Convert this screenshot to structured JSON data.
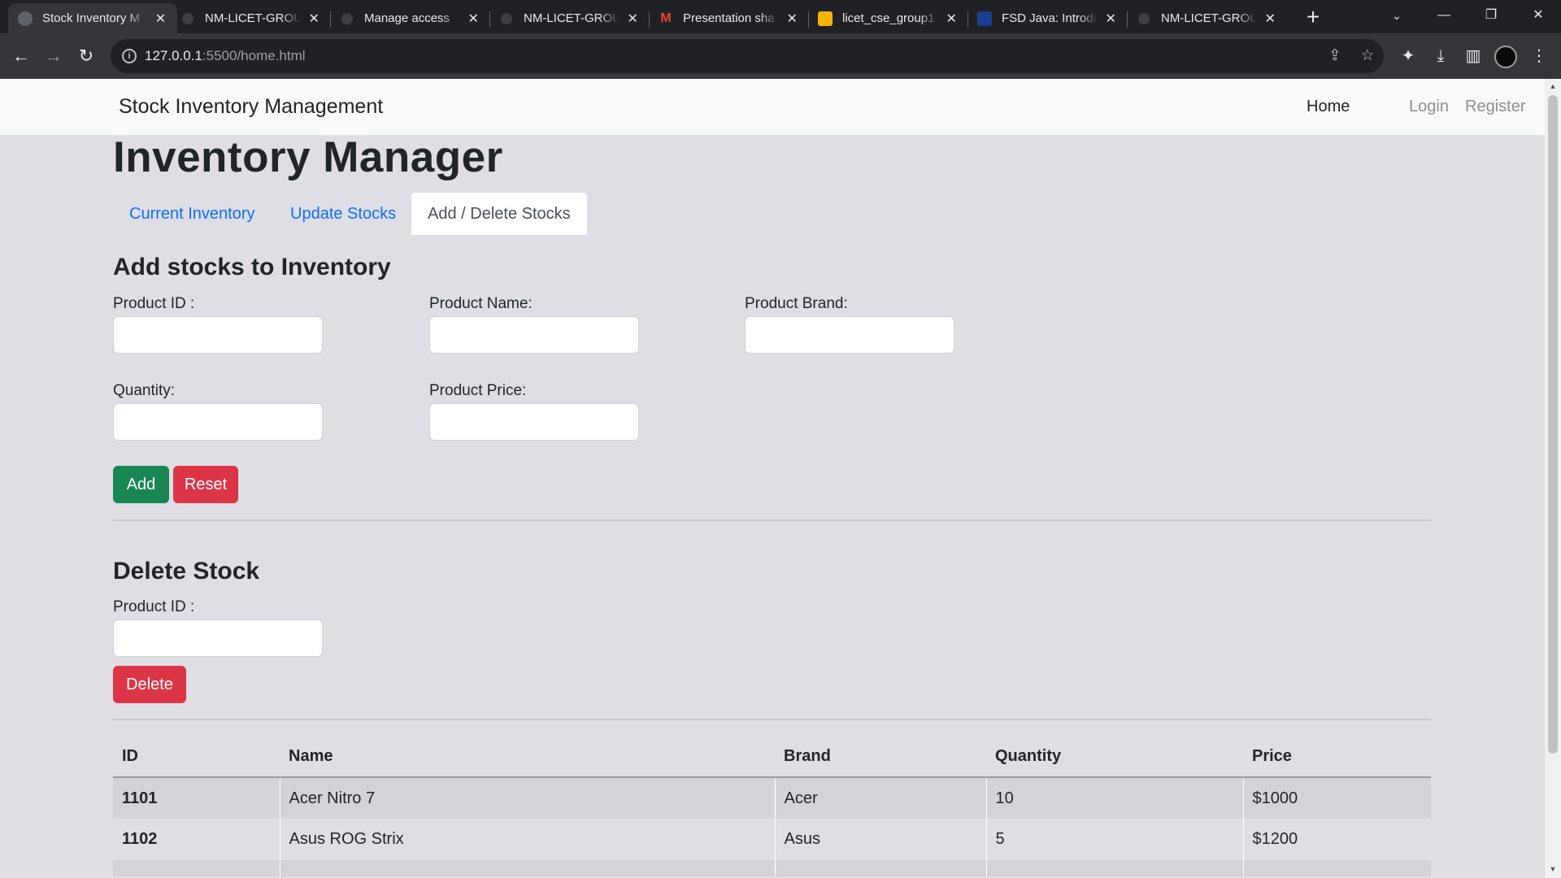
{
  "browser": {
    "tabs": [
      {
        "title": "Stock Inventory M",
        "icon": "globe-icon",
        "active": true
      },
      {
        "title": "NM-LICET-GROU",
        "icon": "github-icon"
      },
      {
        "title": "Manage access",
        "icon": "github-icon"
      },
      {
        "title": "NM-LICET-GROU",
        "icon": "github-icon"
      },
      {
        "title": "Presentation sha",
        "icon": "gmail-icon"
      },
      {
        "title": "licet_cse_group1",
        "icon": "slides-icon"
      },
      {
        "title": "FSD Java: Introdu",
        "icon": "course-icon"
      },
      {
        "title": "NM-LICET-GROU",
        "icon": "github-icon"
      }
    ],
    "url_host": "127.0.0.1",
    "url_rest": ":5500/home.html"
  },
  "navbar": {
    "brand": "Stock Inventory Management",
    "links": {
      "home": "Home",
      "login": "Login",
      "register": "Register"
    }
  },
  "page": {
    "title": "Inventory Manager",
    "tabs": {
      "current": "Current Inventory",
      "update": "Update Stocks",
      "add_delete": "Add / Delete Stocks"
    }
  },
  "add_section": {
    "heading": "Add stocks to Inventory",
    "labels": {
      "product_id": "Product ID :",
      "product_name": "Product Name:",
      "product_brand": "Product Brand:",
      "quantity": "Quantity:",
      "product_price": "Product Price:"
    },
    "buttons": {
      "add": "Add",
      "reset": "Reset"
    }
  },
  "delete_section": {
    "heading": "Delete Stock",
    "label": "Product ID :",
    "button": "Delete"
  },
  "table": {
    "headers": {
      "id": "ID",
      "name": "Name",
      "brand": "Brand",
      "quantity": "Quantity",
      "price": "Price"
    },
    "rows": [
      {
        "id": "1101",
        "name": "Acer Nitro 7",
        "brand": "Acer",
        "quantity": "10",
        "price": "$1000"
      },
      {
        "id": "1102",
        "name": "Asus ROG Strix",
        "brand": "Asus",
        "quantity": "5",
        "price": "$1200"
      }
    ]
  },
  "colors": {
    "primary": "#0d6efd",
    "success": "#198754",
    "danger": "#dc3545",
    "page_bg": "#dedee4"
  }
}
